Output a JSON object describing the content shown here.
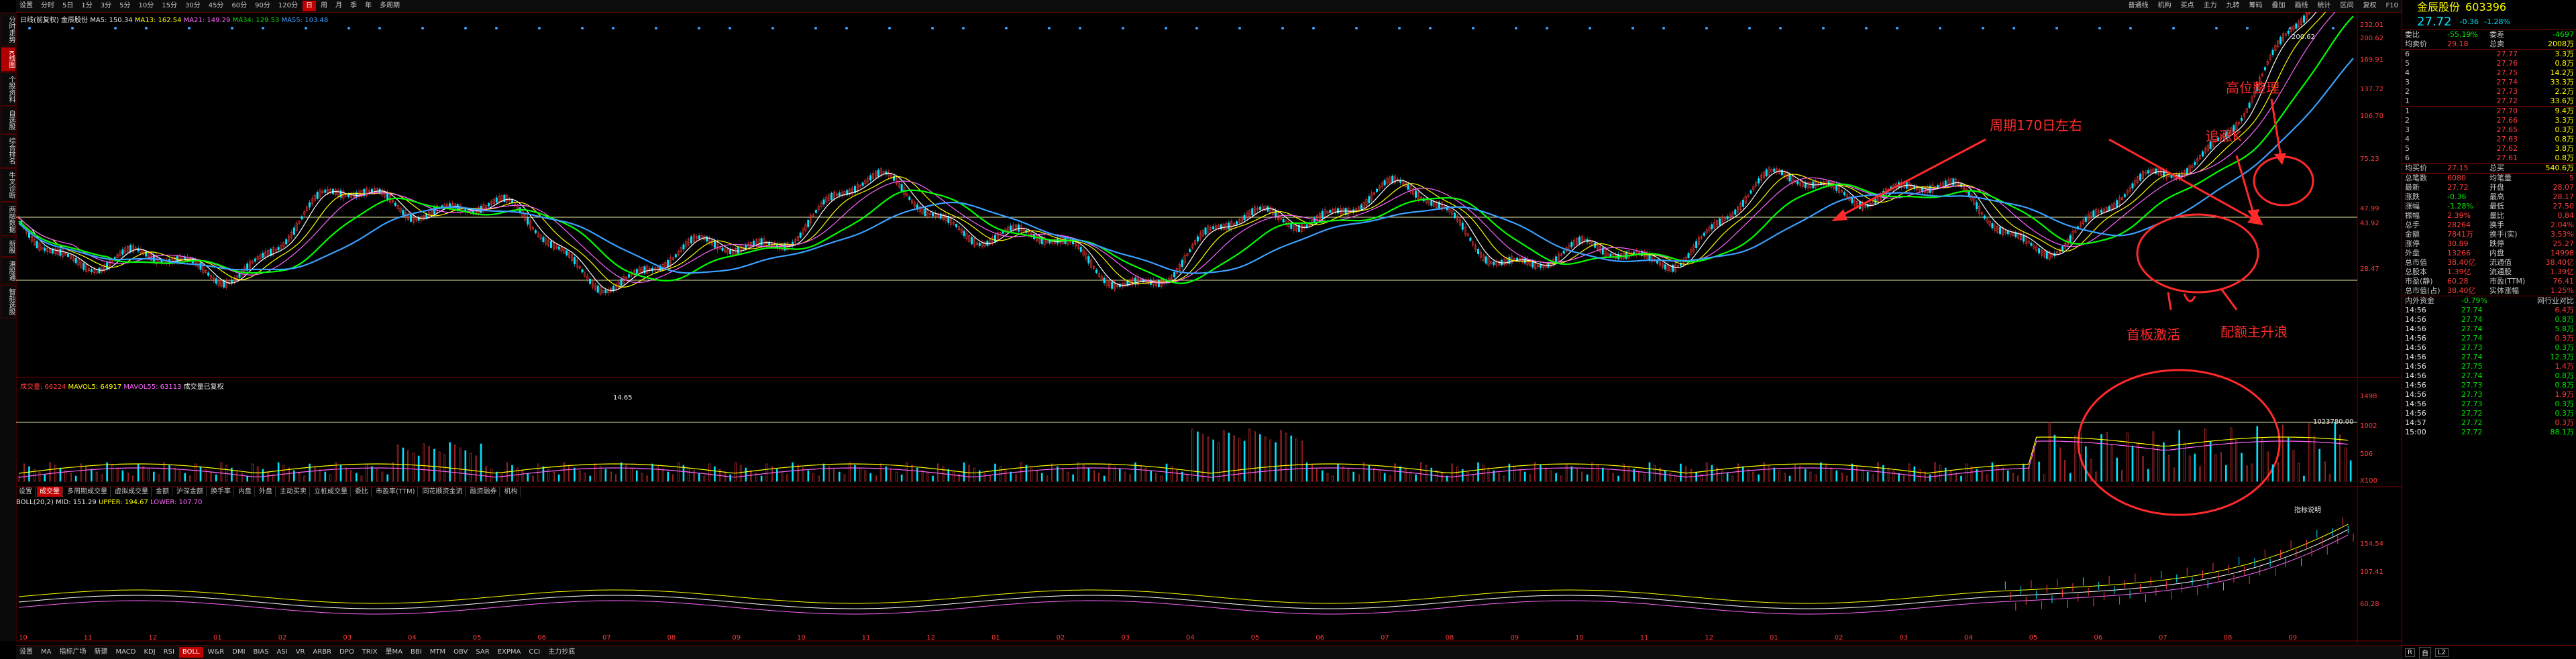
{
  "toolbar": {
    "periods": [
      "分时",
      "5日",
      "1分",
      "3分",
      "5分",
      "10分",
      "15分",
      "30分",
      "45分",
      "60分",
      "90分",
      "120分",
      "日",
      "周",
      "月",
      "季",
      "年",
      "多周期"
    ],
    "active_index": 12,
    "settings": "设置",
    "right_items": [
      "普通线",
      "机构",
      "买点",
      "主力",
      "九转",
      "筹码",
      "叠加",
      "画线",
      "统计",
      "区间",
      "复权",
      "F10"
    ]
  },
  "sidebar": {
    "items": [
      "分时走势",
      "K线图",
      "个股资料",
      "自选股",
      "综合排名",
      "牛叉诊断",
      "两融数据",
      "新股",
      "港股通",
      "智能选股"
    ],
    "active_index": 1
  },
  "main_indicator": {
    "name": "日线(前复权)",
    "stock": "金辰股份",
    "ma5": "MA5: 150.34",
    "ma13": "MA13: 162.54",
    "ma21": "MA21: 149.29",
    "ma34": "MA34: 129.53",
    "ma55": "MA55: 103.48"
  },
  "price_axis": [
    "232.01",
    "200.62",
    "169.91",
    "137.72",
    "106.70",
    "75.23",
    "47.99",
    "43.92",
    "28.47"
  ],
  "price_marks": {
    "high": "200.62",
    "low": "14.65"
  },
  "annotations": {
    "cycle": "周期170日左右",
    "chase": "追涨K",
    "top": "高位整理",
    "start": "首板激活",
    "main": "配额主升浪"
  },
  "volume_indicator": {
    "label": "成交量: 66224",
    "mavol5": "MAVOL5: 64917",
    "mavol55": "MAVOL55: 63113",
    "note": "成交量已复权"
  },
  "volume_axis": [
    "1498",
    "1002",
    "506",
    "X100"
  ],
  "volume_mark": "1023780.00",
  "subtabs": [
    "设置",
    "成交量",
    "多周期成交量",
    "虚拟成交量",
    "金额",
    "沪深金额",
    "换手率",
    "内盘",
    "外盘",
    "主动买卖",
    "立桩成交量",
    "委比",
    "市盈率(TTM)",
    "同花顺资金流",
    "融资融券",
    "机构"
  ],
  "subtab_active": 1,
  "boll_indicator": {
    "label": "BOLL(20,2)",
    "mid": "MID: 151.29",
    "upper": "UPPER: 194.67",
    "lower": "LOWER: 107.70"
  },
  "boll_axis": [
    "154.54",
    "107.41",
    "60.28"
  ],
  "boll_note": "指标说明",
  "time_axis": [
    "10",
    "11",
    "12",
    "01",
    "02",
    "03",
    "04",
    "05",
    "06",
    "07",
    "08",
    "09",
    "10",
    "11",
    "12",
    "01",
    "02",
    "03",
    "04",
    "05",
    "06",
    "07",
    "08",
    "09",
    "10",
    "11",
    "12",
    "01",
    "02",
    "03",
    "04",
    "05",
    "06",
    "07",
    "08",
    "09"
  ],
  "bottombar": {
    "items": [
      "设置",
      "MA",
      "指标广场",
      "新建",
      "MACD",
      "KDJ",
      "RSI",
      "BOLL",
      "W&R",
      "DMI",
      "BIAS",
      "ASI",
      "VR",
      "ARBR",
      "DPO",
      "TRIX",
      "量MA",
      "BBI",
      "MTM",
      "OBV",
      "SAR",
      "EXPMA",
      "CCI",
      "主力抄底"
    ],
    "active_index": 7
  },
  "quote": {
    "name": "金辰股份",
    "code": "603396",
    "price": "27.72",
    "change": "-0.36",
    "pct": "-1.28%",
    "weibi_label": "委比",
    "weibi": "-55.19%",
    "weicha_label": "委差",
    "weicha": "-4697",
    "avg_label": "均卖价",
    "avg_sell": "29.18",
    "total_sell_label": "总卖",
    "total_sell": "2008万",
    "sell": [
      {
        "lv": "6",
        "p": "27.77",
        "v": "3.3万"
      },
      {
        "lv": "5",
        "p": "27.76",
        "v": "0.8万"
      },
      {
        "lv": "4",
        "p": "27.75",
        "v": "14.2万"
      },
      {
        "lv": "3",
        "p": "27.74",
        "v": "33.3万"
      },
      {
        "lv": "2",
        "p": "27.73",
        "v": "2.2万"
      },
      {
        "lv": "1",
        "p": "27.72",
        "v": "33.6万"
      }
    ],
    "buy": [
      {
        "lv": "1",
        "p": "27.70",
        "v": "9.4万"
      },
      {
        "lv": "2",
        "p": "27.66",
        "v": "3.3万"
      },
      {
        "lv": "3",
        "p": "27.65",
        "v": "0.3万"
      },
      {
        "lv": "4",
        "p": "27.63",
        "v": "0.8万"
      },
      {
        "lv": "5",
        "p": "27.62",
        "v": "3.8万"
      },
      {
        "lv": "6",
        "p": "27.61",
        "v": "0.8万"
      }
    ],
    "avg_buy_label": "均买价",
    "avg_buy": "27.15",
    "total_buy_label": "总买",
    "total_buy": "540.6万",
    "stats": [
      [
        "总笔数",
        "6080",
        "均笔量",
        "5"
      ],
      [
        "最新",
        "27.72",
        "开盘",
        "28.07"
      ],
      [
        "涨跌",
        "-0.36",
        "最高",
        "28.17"
      ],
      [
        "涨幅",
        "-1.28%",
        "最低",
        "27.50"
      ],
      [
        "振幅",
        "2.39%",
        "量比",
        "0.84"
      ],
      [
        "总手",
        "28264",
        "换手",
        "2.04%"
      ],
      [
        "金额",
        "7841万",
        "换手(实)",
        "3.53%"
      ],
      [
        "涨停",
        "30.89",
        "跌停",
        "25.27"
      ],
      [
        "外盘",
        "13266",
        "内盘",
        "14998"
      ],
      [
        "总市值",
        "38.40亿",
        "流通值",
        "38.40亿"
      ],
      [
        "总股本",
        "1.39亿",
        "流通股",
        "1.39亿"
      ],
      [
        "市盈(静)",
        "60.28",
        "市盈(TTM)",
        "76.41"
      ],
      [
        "总市值(占)",
        "38.40亿",
        "实体涨幅",
        "1.25%"
      ]
    ],
    "tick_header": [
      "内外资金",
      "-0.79%",
      "网行业对比"
    ],
    "ticks": [
      [
        "14:56",
        "27.74",
        "6.4万"
      ],
      [
        "14:56",
        "27.74",
        "0.8万"
      ],
      [
        "14:56",
        "27.74",
        "5.8万"
      ],
      [
        "14:56",
        "27.74",
        "0.3万"
      ],
      [
        "14:56",
        "27.73",
        "0.3万"
      ],
      [
        "14:56",
        "27.74",
        "12.3万"
      ],
      [
        "14:56",
        "27.75",
        "1.4万"
      ],
      [
        "14:56",
        "27.74",
        "0.8万"
      ],
      [
        "14:56",
        "27.73",
        "0.8万"
      ],
      [
        "14:56",
        "27.73",
        "1.9万"
      ],
      [
        "14:56",
        "27.73",
        "0.3万"
      ],
      [
        "14:56",
        "27.72",
        "0.3万"
      ],
      [
        "14:57",
        "27.72",
        "0.3万"
      ],
      [
        "15:00",
        "27.72",
        "88.1万"
      ]
    ],
    "bottom_icons": [
      "R",
      "自",
      "L2"
    ]
  },
  "colors": {
    "up": "#ff3b3b",
    "down": "#00e5ff",
    "ma5": "#ffffff",
    "ma13": "#ffff00",
    "ma21": "#ff66ff",
    "ma34": "#00ff00",
    "ma55": "#3aa0ff",
    "frame": "#7a0000"
  }
}
